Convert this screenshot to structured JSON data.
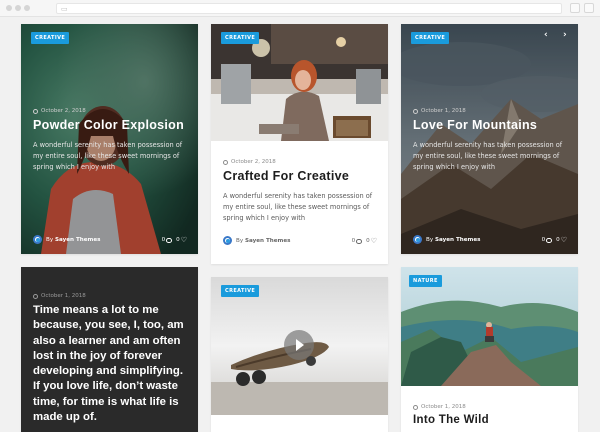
{
  "cards": [
    {
      "category": "CREATIVE",
      "date": "October 2, 2018",
      "title": "Powder Color Explosion",
      "excerpt": "A wonderful serenity has taken possession of my entire soul, like these sweet mornings of spring which I enjoy with",
      "author_prefix": "By",
      "author": "Sayen Themes",
      "comments": "0",
      "likes": "0"
    },
    {
      "category": "CREATIVE",
      "date": "October 2, 2018",
      "title": "Crafted For Creative",
      "excerpt": "A wonderful serenity has taken possession of my entire soul, like these sweet mornings of spring which I enjoy with",
      "author_prefix": "By",
      "author": "Sayen Themes",
      "comments": "0",
      "likes": "0"
    },
    {
      "category": "CREATIVE",
      "date": "October 1, 2018",
      "title": "Love For Mountains",
      "excerpt": "A wonderful serenity has taken possession of my entire soul, like these sweet mornings of spring which I enjoy with",
      "author_prefix": "By",
      "author": "Sayen Themes",
      "comments": "0",
      "likes": "0",
      "prev": "‹",
      "next": "›"
    },
    {
      "date": "October 1, 2018",
      "quote": "Time means a lot to me because, you see, I, too, am also a learner and am often lost in the joy of forever developing and simplifying. If you love life, don’t waste time, for time is what life is made up of."
    },
    {
      "category": "CREATIVE"
    },
    {
      "category": "NATURE",
      "date": "October 1, 2018",
      "title": "Into The Wild"
    }
  ],
  "colors": {
    "badge": "#1a9bdc",
    "dark_card": "#2a2a2a",
    "page_bg": "#f1f1f1"
  },
  "icons": {
    "clock": "clock-icon",
    "comment": "comment-icon",
    "heart": "heart-icon",
    "logo": "sayen-logo-icon",
    "play": "play-icon"
  }
}
